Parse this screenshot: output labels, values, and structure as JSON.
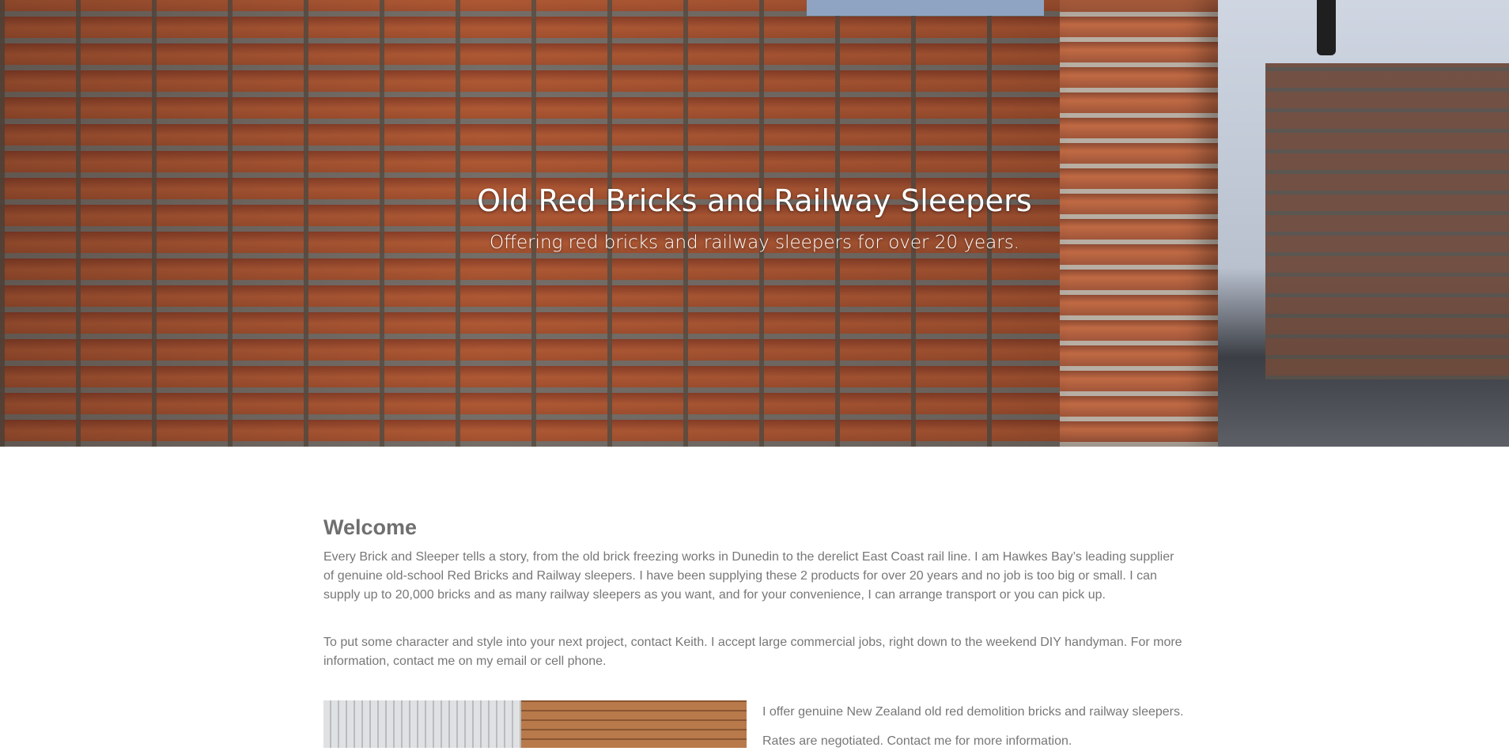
{
  "hero": {
    "title": "Old Red Bricks and Railway Sleepers",
    "subtitle": "Offering red bricks and railway sleepers for over 20 years."
  },
  "welcome": {
    "heading": "Welcome",
    "paragraphs": [
      "Every Brick and Sleeper tells a story, from the old brick freezing works in Dunedin to the derelict East Coast rail line. I am Hawkes Bay’s leading supplier of genuine old-school Red Bricks and Railway sleepers. I have been supplying these 2 products for over 20 years and no job is too big or small. I can supply up to 20,000 bricks and as many railway sleepers as you want, and for your convenience, I can arrange transport or you can pick up.",
      "To put some character and style into your next project, contact Keith. I accept large commercial jobs, right down to the weekend DIY handyman. For more information, contact me on my email or cell phone."
    ]
  },
  "offer": {
    "text": "I offer genuine New Zealand old red demolition bricks and railway sleepers.",
    "rates": "Rates are negotiated. Contact me for more information."
  },
  "colors": {
    "text": "#777777",
    "hero_text": "#ffffff"
  }
}
